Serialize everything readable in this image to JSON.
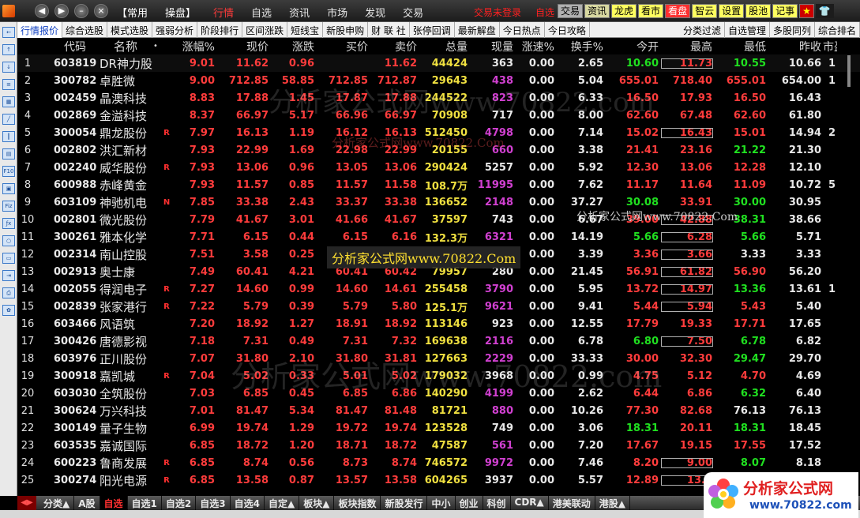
{
  "titlebar": {
    "menu": [
      "【常用",
      "操盘】",
      "行情",
      "自选",
      "资讯",
      "市场",
      "发现",
      "交易"
    ],
    "active_index": 2,
    "login_status": "交易未登录",
    "login_status_extra": "自选",
    "right_buttons": [
      "交易",
      "资讯",
      "龙虎",
      "看市",
      "看盘",
      "智云",
      "设置",
      "股池",
      "记事",
      "★"
    ]
  },
  "filter_tabs": [
    "行情报价",
    "综合选股",
    "模式选股",
    "强弱分析",
    "阶段排行",
    "区间涨跌",
    "短线宝",
    "新股申购",
    "财 联 社",
    "张停回调",
    "最新解盘",
    "今日热点",
    "今日攻略",
    "分类过滤",
    "自选管理",
    "多股同列",
    "综合排名"
  ],
  "columns": [
    "",
    "代码",
    "名称",
    "•",
    "涨幅%",
    "现价",
    "涨跌",
    "买价",
    "卖价",
    "总量",
    "现量",
    "涨速%",
    "换手%",
    "今开",
    "最高",
    "最低",
    "昨收",
    "市盈"
  ],
  "rows": [
    {
      "idx": "1",
      "code": "603819",
      "name": "DR神力股",
      "mk": "",
      "pct": "9.01",
      "price": "11.62",
      "chg": "0.96",
      "buy": "",
      "sell": "11.62",
      "vol": "44424",
      "cur": "363",
      "spd": "0.00",
      "turn": "2.65",
      "open": "10.60",
      "high": "11.73",
      "low": "10.55",
      "prev": "10.66",
      "more": "1"
    },
    {
      "idx": "2",
      "code": "300782",
      "name": "卓胜微",
      "mk": "",
      "pct": "9.00",
      "price": "712.85",
      "chg": "58.85",
      "buy": "712.85",
      "sell": "712.87",
      "vol": "29643",
      "cur": "438",
      "spd": "0.00",
      "turn": "5.04",
      "open": "655.01",
      "high": "718.40",
      "low": "655.01",
      "prev": "654.00",
      "more": "1"
    },
    {
      "idx": "3",
      "code": "002459",
      "name": "晶澳科技",
      "mk": "",
      "pct": "8.83",
      "price": "17.88",
      "chg": "1.45",
      "buy": "17.87",
      "sell": "17.88",
      "vol": "244522",
      "cur": "823",
      "spd": "0.00",
      "turn": "6.33",
      "open": "16.50",
      "high": "17.93",
      "low": "16.50",
      "prev": "16.43",
      "more": ""
    },
    {
      "idx": "4",
      "code": "002869",
      "name": "金溢科技",
      "mk": "",
      "pct": "8.37",
      "price": "66.97",
      "chg": "5.17",
      "buy": "66.96",
      "sell": "66.97",
      "vol": "70908",
      "cur": "717",
      "spd": "0.00",
      "turn": "8.00",
      "open": "62.60",
      "high": "67.48",
      "low": "62.60",
      "prev": "61.80",
      "more": ""
    },
    {
      "idx": "5",
      "code": "300054",
      "name": "鼎龙股份",
      "mk": "R",
      "pct": "7.97",
      "price": "16.13",
      "chg": "1.19",
      "buy": "16.12",
      "sell": "16.13",
      "vol": "512450",
      "cur": "4798",
      "spd": "0.00",
      "turn": "7.14",
      "open": "15.02",
      "high": "16.43",
      "low": "15.01",
      "prev": "14.94",
      "more": "2"
    },
    {
      "idx": "6",
      "code": "002802",
      "name": "洪汇新材",
      "mk": "",
      "pct": "7.93",
      "price": "22.99",
      "chg": "1.69",
      "buy": "22.98",
      "sell": "22.99",
      "vol": "20155",
      "cur": "660",
      "spd": "0.00",
      "turn": "3.38",
      "open": "21.41",
      "high": "23.16",
      "low": "21.22",
      "prev": "21.30",
      "more": ""
    },
    {
      "idx": "7",
      "code": "002240",
      "name": "威华股份",
      "mk": "R",
      "pct": "7.93",
      "price": "13.06",
      "chg": "0.96",
      "buy": "13.05",
      "sell": "13.06",
      "vol": "290424",
      "cur": "5257",
      "spd": "0.00",
      "turn": "5.92",
      "open": "12.30",
      "high": "13.06",
      "low": "12.28",
      "prev": "12.10",
      "more": ""
    },
    {
      "idx": "8",
      "code": "600988",
      "name": "赤峰黄金",
      "mk": "",
      "pct": "7.93",
      "price": "11.57",
      "chg": "0.85",
      "buy": "11.57",
      "sell": "11.58",
      "vol": "108.7万",
      "cur": "11995",
      "spd": "0.00",
      "turn": "7.62",
      "open": "11.17",
      "high": "11.64",
      "low": "11.09",
      "prev": "10.72",
      "more": "5"
    },
    {
      "idx": "9",
      "code": "603109",
      "name": "神驰机电",
      "mk": "N",
      "pct": "7.85",
      "price": "33.38",
      "chg": "2.43",
      "buy": "33.37",
      "sell": "33.38",
      "vol": "136652",
      "cur": "2148",
      "spd": "0.00",
      "turn": "37.27",
      "open": "30.08",
      "high": "33.91",
      "low": "30.00",
      "prev": "30.95",
      "more": ""
    },
    {
      "idx": "10",
      "code": "002801",
      "name": "微光股份",
      "mk": "",
      "pct": "7.79",
      "price": "41.67",
      "chg": "3.01",
      "buy": "41.66",
      "sell": "41.67",
      "vol": "37597",
      "cur": "743",
      "spd": "0.00",
      "turn": "6.67",
      "open": "39.00",
      "high": "42.88",
      "low": "38.31",
      "prev": "38.66",
      "more": ""
    },
    {
      "idx": "11",
      "code": "300261",
      "name": "雅本化学",
      "mk": "",
      "pct": "7.71",
      "price": "6.15",
      "chg": "0.44",
      "buy": "6.15",
      "sell": "6.16",
      "vol": "132.3万",
      "cur": "6321",
      "spd": "0.00",
      "turn": "14.19",
      "open": "5.66",
      "high": "6.28",
      "low": "5.66",
      "prev": "5.71",
      "more": ""
    },
    {
      "idx": "12",
      "code": "002314",
      "name": "南山控股",
      "mk": "",
      "pct": "7.51",
      "price": "3.58",
      "chg": "0.25",
      "buy": "",
      "sell": "",
      "vol": "",
      "cur": "",
      "spd": "0.00",
      "turn": "3.39",
      "open": "3.36",
      "high": "3.66",
      "low": "3.33",
      "prev": "3.33",
      "more": ""
    },
    {
      "idx": "13",
      "code": "002913",
      "name": "奥士康",
      "mk": "",
      "pct": "7.49",
      "price": "60.41",
      "chg": "4.21",
      "buy": "60.41",
      "sell": "60.42",
      "vol": "79957",
      "cur": "280",
      "spd": "0.00",
      "turn": "21.45",
      "open": "56.91",
      "high": "61.82",
      "low": "56.90",
      "prev": "56.20",
      "more": ""
    },
    {
      "idx": "14",
      "code": "002055",
      "name": "得润电子",
      "mk": "R",
      "pct": "7.27",
      "price": "14.60",
      "chg": "0.99",
      "buy": "14.60",
      "sell": "14.61",
      "vol": "255458",
      "cur": "3790",
      "spd": "0.00",
      "turn": "5.95",
      "open": "13.72",
      "high": "14.97",
      "low": "13.36",
      "prev": "13.61",
      "more": "1"
    },
    {
      "idx": "15",
      "code": "002839",
      "name": "张家港行",
      "mk": "R",
      "pct": "7.22",
      "price": "5.79",
      "chg": "0.39",
      "buy": "5.79",
      "sell": "5.80",
      "vol": "125.1万",
      "cur": "9621",
      "spd": "0.00",
      "turn": "9.41",
      "open": "5.44",
      "high": "5.94",
      "low": "5.43",
      "prev": "5.40",
      "more": ""
    },
    {
      "idx": "16",
      "code": "603466",
      "name": "风语筑",
      "mk": "",
      "pct": "7.20",
      "price": "18.92",
      "chg": "1.27",
      "buy": "18.91",
      "sell": "18.92",
      "vol": "113146",
      "cur": "923",
      "spd": "0.00",
      "turn": "12.55",
      "open": "17.79",
      "high": "19.33",
      "low": "17.71",
      "prev": "17.65",
      "more": ""
    },
    {
      "idx": "17",
      "code": "300426",
      "name": "唐德影视",
      "mk": "",
      "pct": "7.18",
      "price": "7.31",
      "chg": "0.49",
      "buy": "7.31",
      "sell": "7.32",
      "vol": "169638",
      "cur": "2116",
      "spd": "0.00",
      "turn": "6.78",
      "open": "6.80",
      "high": "7.50",
      "low": "6.78",
      "prev": "6.82",
      "more": ""
    },
    {
      "idx": "18",
      "code": "603976",
      "name": "正川股份",
      "mk": "",
      "pct": "7.07",
      "price": "31.80",
      "chg": "2.10",
      "buy": "31.80",
      "sell": "31.81",
      "vol": "127663",
      "cur": "2229",
      "spd": "0.00",
      "turn": "33.33",
      "open": "30.00",
      "high": "32.30",
      "low": "29.47",
      "prev": "29.70",
      "more": ""
    },
    {
      "idx": "19",
      "code": "300918",
      "name": "嘉凯城",
      "mk": "R",
      "pct": "7.04",
      "price": "5.02",
      "chg": "0.33",
      "buy": "5.01",
      "sell": "5.02",
      "vol": "179032",
      "cur": "3968",
      "spd": "0.00",
      "turn": "0.99",
      "open": "4.75",
      "high": "5.12",
      "low": "4.70",
      "prev": "4.69",
      "more": ""
    },
    {
      "idx": "20",
      "code": "603030",
      "name": "全筑股份",
      "mk": "",
      "pct": "7.03",
      "price": "6.85",
      "chg": "0.45",
      "buy": "6.85",
      "sell": "6.86",
      "vol": "140290",
      "cur": "4199",
      "spd": "0.00",
      "turn": "2.62",
      "open": "6.44",
      "high": "6.86",
      "low": "6.32",
      "prev": "6.40",
      "more": ""
    },
    {
      "idx": "21",
      "code": "300624",
      "name": "万兴科技",
      "mk": "",
      "pct": "7.01",
      "price": "81.47",
      "chg": "5.34",
      "buy": "81.47",
      "sell": "81.48",
      "vol": "81721",
      "cur": "880",
      "spd": "0.00",
      "turn": "10.26",
      "open": "77.30",
      "high": "82.68",
      "low": "76.13",
      "prev": "76.13",
      "more": ""
    },
    {
      "idx": "22",
      "code": "300149",
      "name": "量子生物",
      "mk": "",
      "pct": "6.99",
      "price": "19.74",
      "chg": "1.29",
      "buy": "19.72",
      "sell": "19.74",
      "vol": "123528",
      "cur": "749",
      "spd": "0.00",
      "turn": "3.06",
      "open": "18.31",
      "high": "20.11",
      "low": "18.31",
      "prev": "18.45",
      "more": ""
    },
    {
      "idx": "23",
      "code": "603535",
      "name": "嘉诚国际",
      "mk": "",
      "pct": "6.85",
      "price": "18.72",
      "chg": "1.20",
      "buy": "18.71",
      "sell": "18.72",
      "vol": "47587",
      "cur": "561",
      "spd": "0.00",
      "turn": "7.20",
      "open": "17.67",
      "high": "19.15",
      "low": "17.55",
      "prev": "17.52",
      "more": ""
    },
    {
      "idx": "24",
      "code": "600223",
      "name": "鲁商发展",
      "mk": "R",
      "pct": "6.85",
      "price": "8.74",
      "chg": "0.56",
      "buy": "8.73",
      "sell": "8.74",
      "vol": "746572",
      "cur": "9972",
      "spd": "0.00",
      "turn": "7.46",
      "open": "8.20",
      "high": "9.00",
      "low": "8.07",
      "prev": "8.18",
      "more": ""
    },
    {
      "idx": "25",
      "code": "300274",
      "name": "阳光电源",
      "mk": "R",
      "pct": "6.85",
      "price": "13.58",
      "chg": "0.87",
      "buy": "13.57",
      "sell": "13.58",
      "vol": "604265",
      "cur": "3937",
      "spd": "0.00",
      "turn": "5.57",
      "open": "12.89",
      "high": "13.5",
      "low": "",
      "prev": "",
      "more": ""
    }
  ],
  "bottom_tabs": [
    "分类▲",
    "A股",
    "自选",
    "自选1",
    "自选2",
    "自选3",
    "自选4",
    "自定▲",
    "板块▲",
    "板块指数",
    "新股发行",
    "中小",
    "创业",
    "科创",
    "CDR▲",
    "港美联动",
    "港股▲"
  ],
  "bottom_active_index": 2,
  "watermarks": {
    "w1": "分析家公式网www.70822.com",
    "w2": "分析家公式网www.70822.Com",
    "w3": "分析家公式网www.70822.Com",
    "w4": "分析家公式网www.70822.Com",
    "w5": "分析家公式网www.70822.com"
  },
  "brand": {
    "name": "分析家公式网",
    "url": "www.70822.com"
  },
  "colors": {
    "up": "#ff3c3c",
    "down": "#20e020",
    "flat": "#e8e8e8",
    "volume": "#f0e040",
    "current_volume": "#d040d0",
    "selected_tab": "#ff3030"
  }
}
